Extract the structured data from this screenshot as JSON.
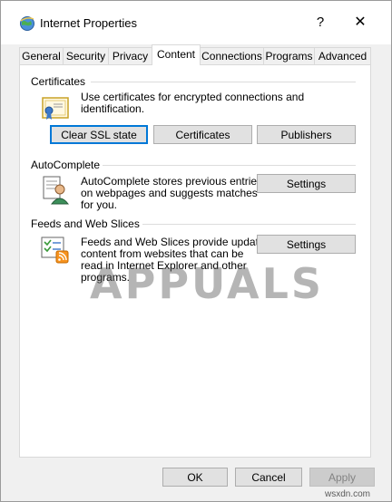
{
  "window": {
    "title": "Internet Properties",
    "help_glyph": "?",
    "close_glyph": "✕"
  },
  "tabs": [
    {
      "label": "General"
    },
    {
      "label": "Security"
    },
    {
      "label": "Privacy"
    },
    {
      "label": "Content",
      "active": true
    },
    {
      "label": "Connections"
    },
    {
      "label": "Programs"
    },
    {
      "label": "Advanced"
    }
  ],
  "certificates": {
    "heading": "Certificates",
    "description": "Use certificates for encrypted connections and identification.",
    "clear_ssl_label": "Clear SSL state",
    "certificates_label": "Certificates",
    "publishers_label": "Publishers"
  },
  "autocomplete": {
    "heading": "AutoComplete",
    "description_1": "AutoComplete stores previous entries",
    "description_2": "on webpages and suggests matches",
    "description_3": "for you.",
    "settings_label": "Settings"
  },
  "feeds": {
    "heading": "Feeds and Web Slices",
    "description_1": "Feeds and Web Slices provide updated",
    "description_2": "content from websites that can be",
    "description_3": "read in Internet Explorer and other",
    "description_4": "programs.",
    "settings_label": "Settings"
  },
  "footer": {
    "ok_label": "OK",
    "cancel_label": "Cancel",
    "apply_label": "Apply"
  },
  "watermark": {
    "text": "APPUALS",
    "site": "wsxdn.com"
  },
  "colors": {
    "focus_border": "#0078d7",
    "tab_border": "#d9d9d9"
  }
}
